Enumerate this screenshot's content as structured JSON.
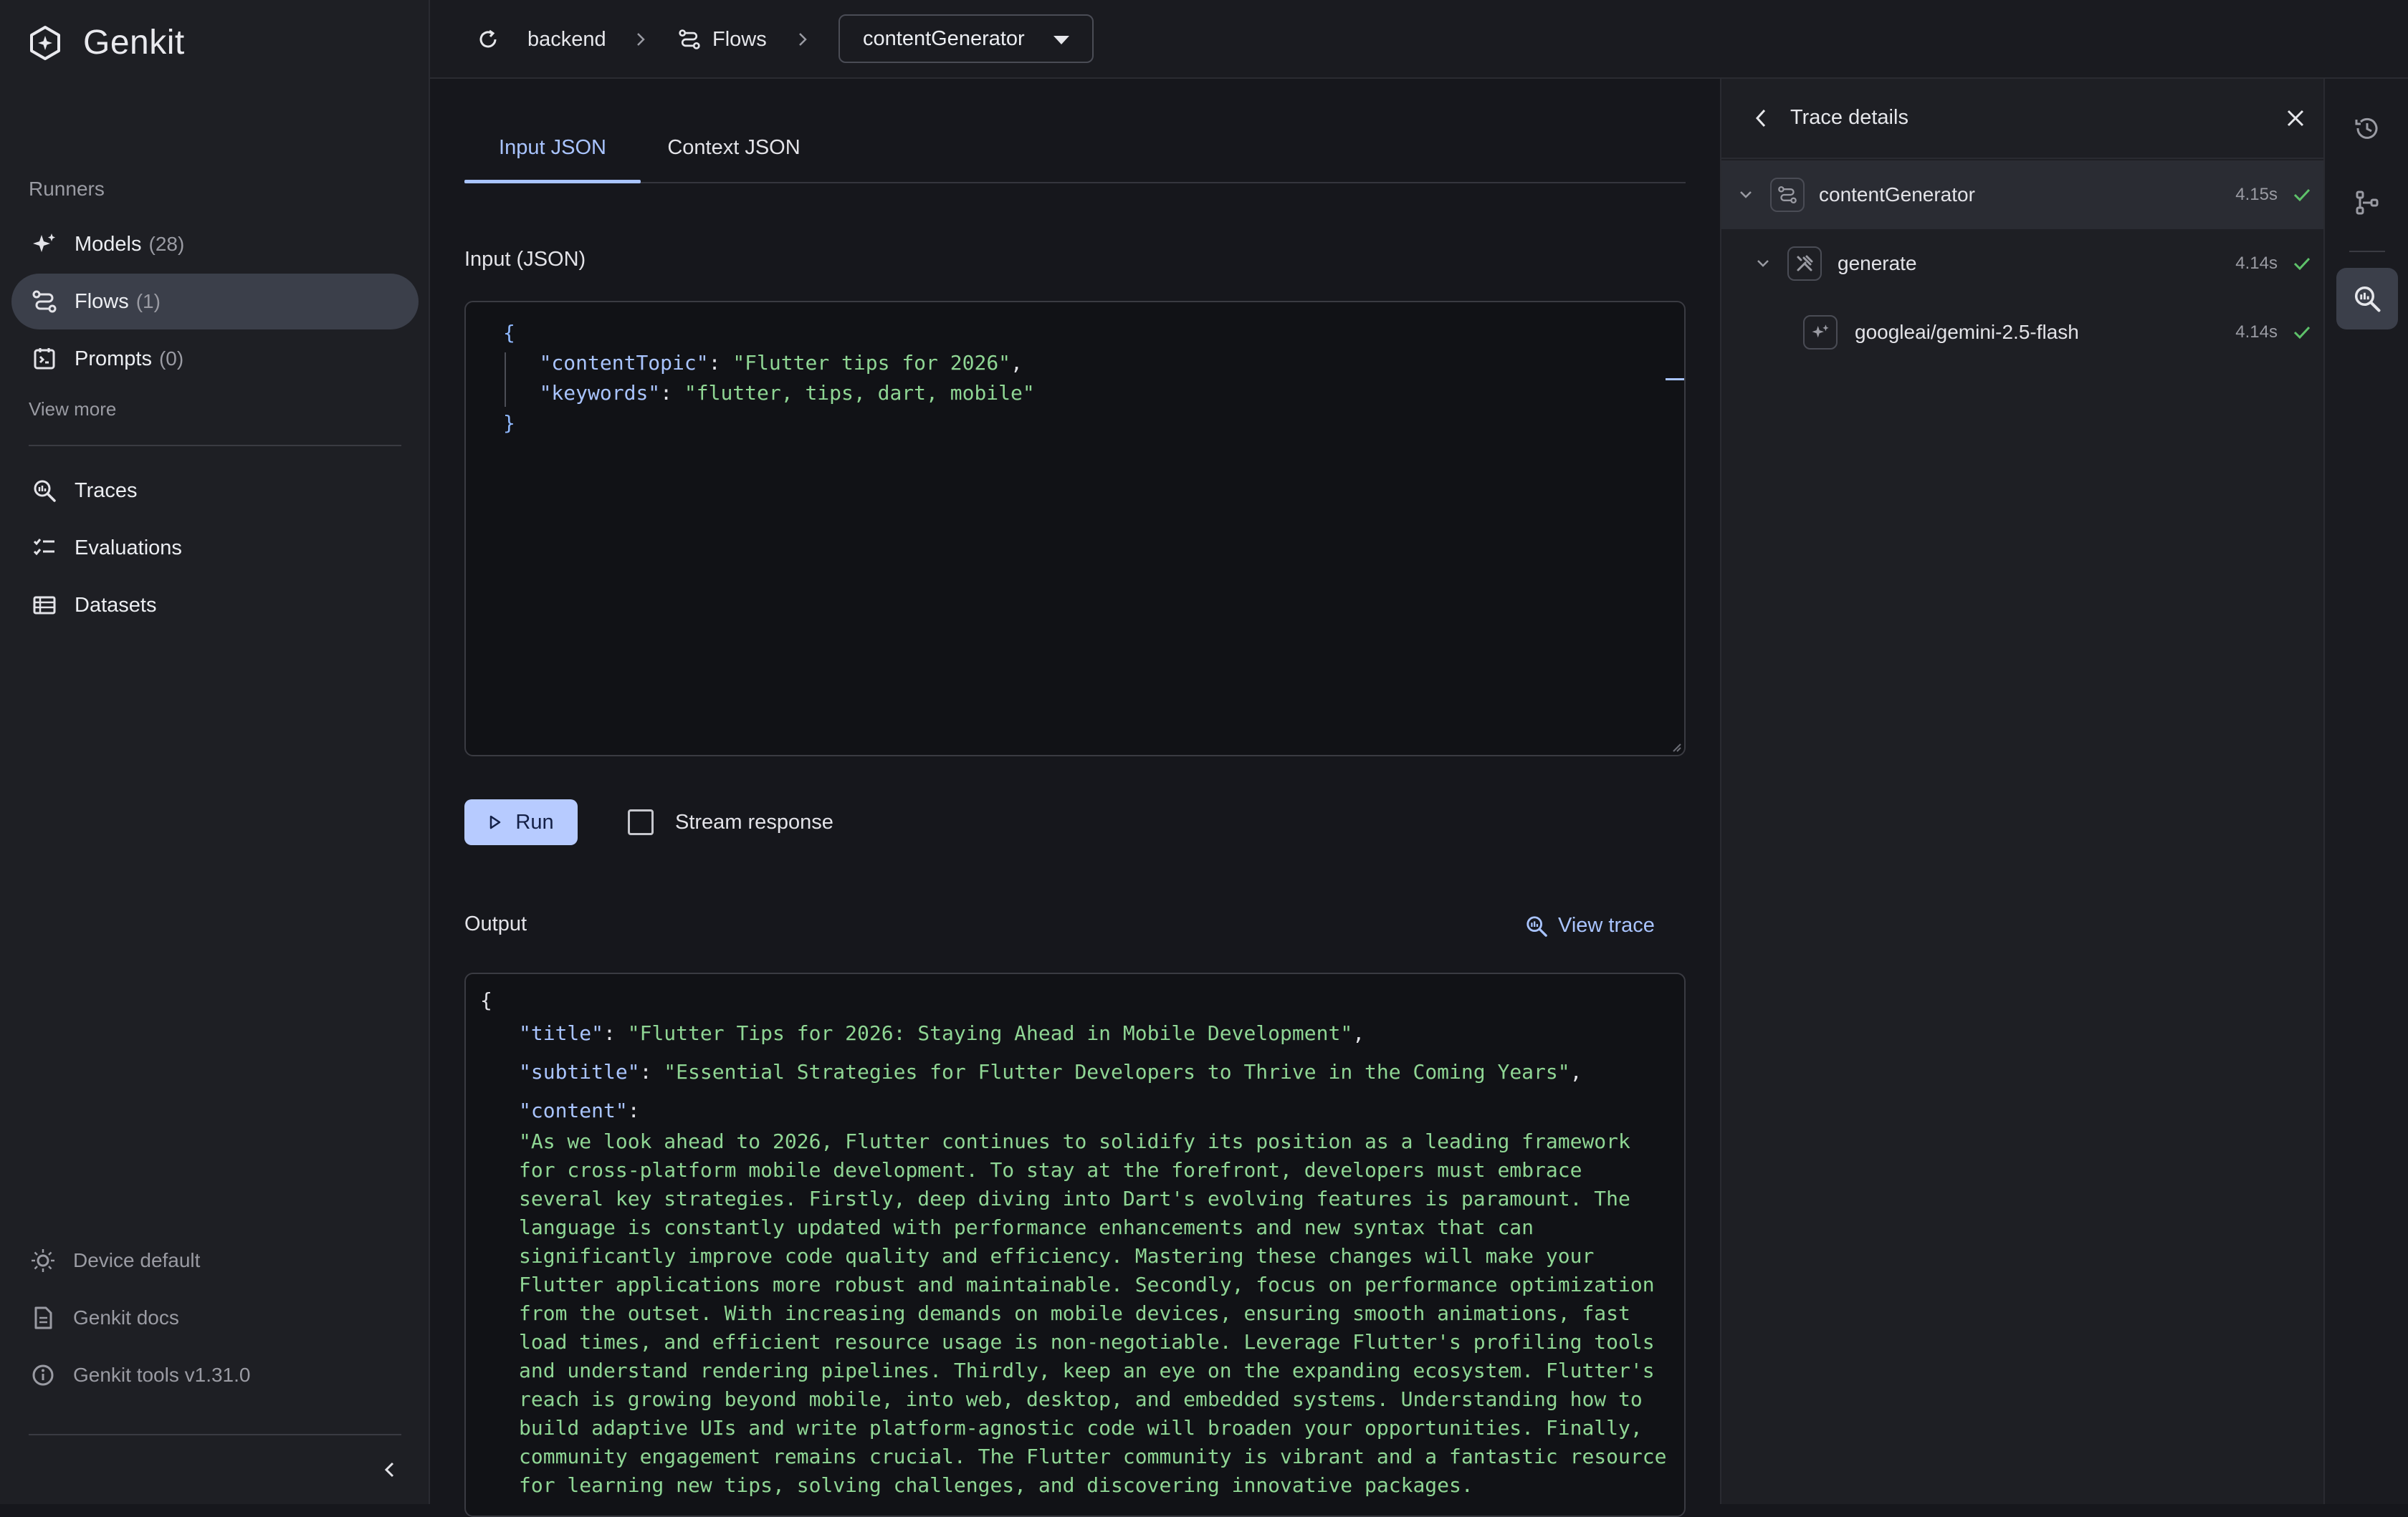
{
  "app": {
    "name": "Genkit"
  },
  "sidebar": {
    "section_label": "Runners",
    "items": [
      {
        "label": "Models",
        "count": "(28)",
        "icon": "sparkle-icon",
        "active": false
      },
      {
        "label": "Flows",
        "count": "(1)",
        "icon": "flow-icon",
        "active": true
      },
      {
        "label": "Prompts",
        "count": "(0)",
        "icon": "prompt-icon",
        "active": false
      }
    ],
    "view_more": "View more",
    "tools": [
      {
        "label": "Traces",
        "icon": "trace-search-icon"
      },
      {
        "label": "Evaluations",
        "icon": "checklist-icon"
      },
      {
        "label": "Datasets",
        "icon": "table-icon"
      }
    ],
    "footer": [
      {
        "label": "Device default",
        "icon": "theme-icon"
      },
      {
        "label": "Genkit docs",
        "icon": "document-icon"
      },
      {
        "label": "Genkit tools v1.31.0",
        "icon": "info-icon"
      }
    ]
  },
  "topbar": {
    "breadcrumb": [
      "backend",
      "Flows"
    ],
    "flow_select": "contentGenerator"
  },
  "main": {
    "tabs": [
      "Input JSON",
      "Context JSON"
    ],
    "input_label": "Input (JSON)",
    "input_json": {
      "open": "{",
      "key1": "\"contentTopic\"",
      "val1": "\"Flutter tips for 2026\"",
      "key2": "\"keywords\"",
      "val2": "\"flutter, tips, dart, mobile\"",
      "close": "}"
    },
    "run_label": "Run",
    "stream_label": "Stream response",
    "output_label": "Output",
    "view_trace_label": "View trace",
    "output": {
      "open": "{",
      "title_key": "\"title\"",
      "title_val": "\"Flutter Tips for 2026: Staying Ahead in Mobile Development\"",
      "subtitle_key": "\"subtitle\"",
      "subtitle_val": "\"Essential Strategies for Flutter Developers to Thrive in the Coming Years\"",
      "content_key": "\"content\"",
      "content_val": "\"As we look ahead to 2026, Flutter continues to solidify its position as a leading framework for cross-platform mobile development. To stay at the forefront, developers must embrace several key strategies. Firstly, deep diving into Dart's evolving features is paramount. The language is constantly updated with performance enhancements and new syntax that can significantly improve code quality and efficiency. Mastering these changes will make your Flutter applications more robust and maintainable. Secondly, focus on performance optimization from the outset. With increasing demands on mobile devices, ensuring smooth animations, fast load times, and efficient resource usage is non-negotiable. Leverage Flutter's profiling tools and understand rendering pipelines. Thirdly, keep an eye on the expanding ecosystem. Flutter's reach is growing beyond mobile, into web, desktop, and embedded systems. Understanding how to build adaptive UIs and write platform-agnostic code will broaden your opportunities. Finally, community engagement remains crucial. The Flutter community is vibrant and a fantastic resource for learning new tips, solving challenges, and discovering innovative packages."
    }
  },
  "trace": {
    "title": "Trace details",
    "spans": [
      {
        "name": "contentGenerator",
        "duration": "4.15s",
        "icon": "flow-icon",
        "status": "success"
      },
      {
        "name": "generate",
        "duration": "4.14s",
        "icon": "tools-icon",
        "status": "success"
      },
      {
        "name": "googleai/gemini-2.5-flash",
        "duration": "4.14s",
        "icon": "sparkle-icon",
        "status": "success"
      }
    ]
  },
  "colors": {
    "accent": "#a9c4ff",
    "success": "#5ec26a",
    "json_string": "#8fd694",
    "background": "#16171c",
    "sidebar": "#1e1f24"
  }
}
